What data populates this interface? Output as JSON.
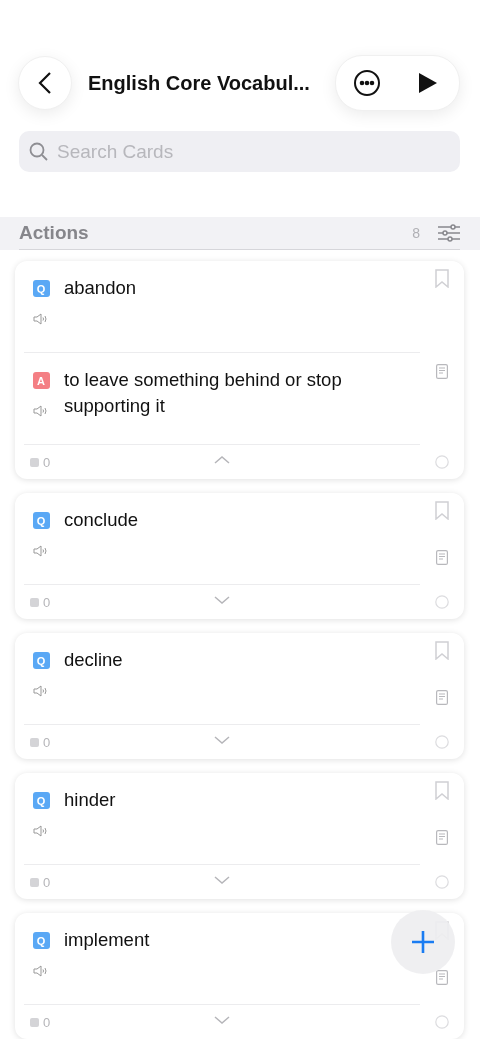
{
  "header": {
    "title": "English Core Vocabul..."
  },
  "search": {
    "placeholder": "Search Cards"
  },
  "section": {
    "title": "Actions",
    "count": "8"
  },
  "cards": [
    {
      "question_badge": "Q",
      "question": "abandon",
      "answer_badge": "A",
      "answer": "to leave something behind or stop supporting it",
      "count": "0",
      "expanded": true
    },
    {
      "question_badge": "Q",
      "question": "conclude",
      "count": "0",
      "expanded": false
    },
    {
      "question_badge": "Q",
      "question": "decline",
      "count": "0",
      "expanded": false
    },
    {
      "question_badge": "Q",
      "question": "hinder",
      "count": "0",
      "expanded": false
    },
    {
      "question_badge": "Q",
      "question": "implement",
      "count": "0",
      "expanded": false
    }
  ]
}
